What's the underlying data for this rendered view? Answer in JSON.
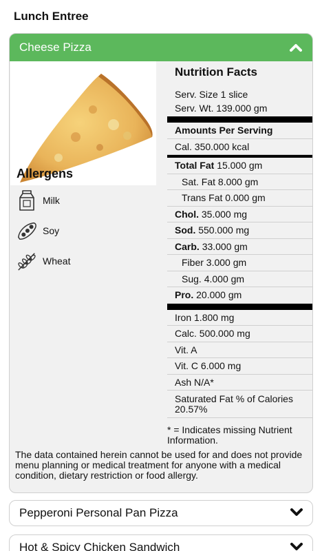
{
  "page": {
    "title": "Lunch Entree"
  },
  "open_item": {
    "name": "Cheese Pizza",
    "header_color": "#5cb85c",
    "allergens_title": "Allergens",
    "allergens": [
      {
        "icon": "milk-carton-icon",
        "label": "Milk"
      },
      {
        "icon": "soybean-icon",
        "label": "Soy"
      },
      {
        "icon": "wheat-icon",
        "label": "Wheat"
      }
    ],
    "nutrition": {
      "title": "Nutrition Facts",
      "serv_size": "Serv. Size 1 slice",
      "serv_wt": "Serv. Wt. 139.000 gm",
      "amounts_header": "Amounts Per Serving",
      "cal": "Cal. 350.000 kcal",
      "total_fat_label": "Total Fat",
      "total_fat_value": "15.000 gm",
      "sat_fat": "Sat. Fat 8.000 gm",
      "trans_fat": "Trans Fat 0.000 gm",
      "chol_label": "Chol.",
      "chol_value": "35.000 mg",
      "sod_label": "Sod.",
      "sod_value": "550.000 mg",
      "carb_label": "Carb.",
      "carb_value": "33.000 gm",
      "fiber": "Fiber 3.000 gm",
      "sug": "Sug. 4.000 gm",
      "pro_label": "Pro.",
      "pro_value": "20.000 gm",
      "iron": "Iron 1.800 mg",
      "calc": "Calc. 500.000 mg",
      "vit_a": "Vit. A",
      "vit_c": "Vit. C 6.000 mg",
      "ash": "Ash N/A*",
      "sat_fat_pct": "Saturated Fat % of Calories 20.57%"
    },
    "missing_note": "* = Indicates missing Nutrient Information.",
    "disclaimer": "The data contained herein cannot be used for and does not provide menu planning or medical treatment for anyone with a medical condition, dietary restriction or food allergy."
  },
  "closed_items": [
    {
      "name": "Pepperoni Personal Pan Pizza"
    },
    {
      "name": "Hot & Spicy Chicken Sandwich"
    }
  ]
}
